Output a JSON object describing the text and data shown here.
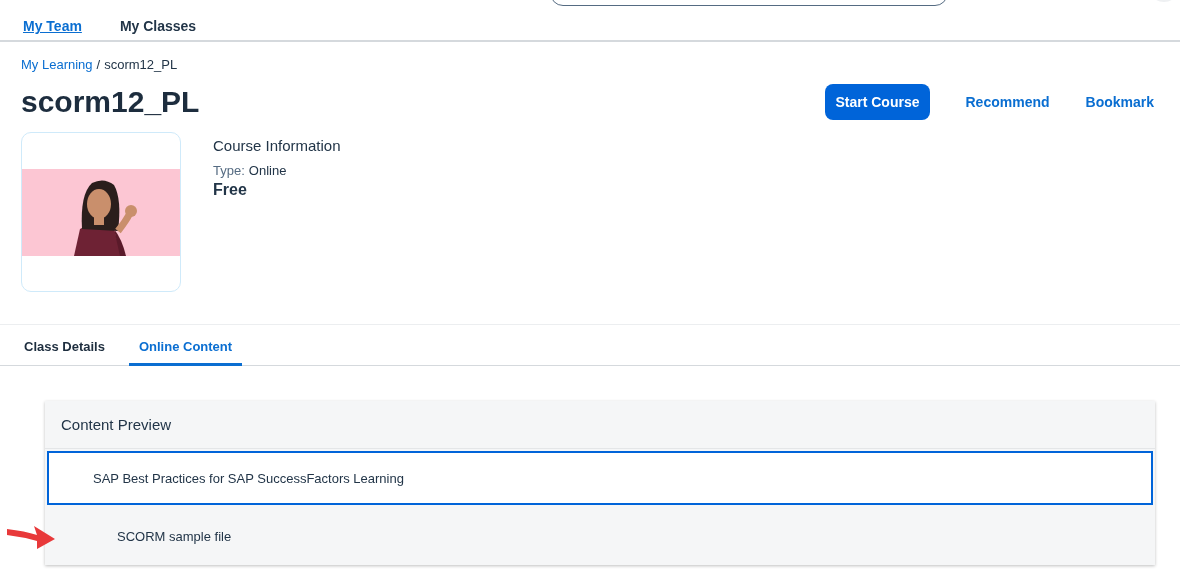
{
  "header": {
    "nav": [
      {
        "label": "My Team",
        "selected": true
      },
      {
        "label": "My Classes",
        "selected": false
      }
    ]
  },
  "breadcrumb": [
    {
      "label": "My Learning",
      "kind": "link"
    },
    {
      "label": "scorm12_PL",
      "kind": "current"
    }
  ],
  "breadcrumb_separator": "/",
  "title": "scorm12_PL",
  "actions": [
    {
      "label": "Start Course",
      "kind": "primary"
    },
    {
      "label": "Recommend",
      "kind": "link"
    },
    {
      "label": "Bookmark",
      "kind": "link"
    }
  ],
  "course_info": {
    "heading": "Course Information",
    "type_label": "Type:",
    "type_value": "Online",
    "price": "Free"
  },
  "tabs": [
    {
      "label": "Class Details",
      "selected": false
    },
    {
      "label": "Online Content",
      "selected": true
    }
  ],
  "content_preview": {
    "title": "Content Preview",
    "items": [
      {
        "label": "SAP Best Practices for SAP SuccessFactors Learning",
        "selected": true,
        "children": [
          {
            "label": "SCORM sample file",
            "selected": false,
            "annotated": true
          }
        ]
      }
    ]
  }
}
